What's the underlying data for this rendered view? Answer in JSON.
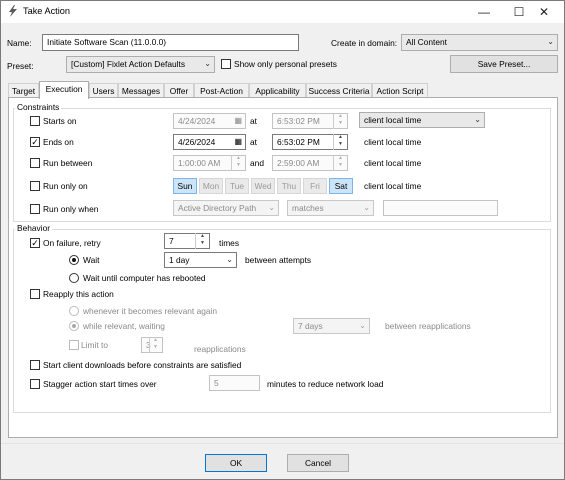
{
  "window": {
    "title": "Take Action",
    "minimize_glyph": "—",
    "maximize_glyph": "☐",
    "close_glyph": "✕"
  },
  "form": {
    "name_label": "Name:",
    "name_value": "Initiate Software Scan (11.0.0.0)",
    "domain_label": "Create in domain:",
    "domain_value": "All Content",
    "preset_label": "Preset:",
    "preset_value": "[Custom] Fixlet Action Defaults",
    "personal_presets_label": "Show only personal presets",
    "save_preset_label": "Save Preset..."
  },
  "tabs": [
    "Target",
    "Execution",
    "Users",
    "Messages",
    "Offer",
    "Post-Action",
    "Applicability",
    "Success Criteria",
    "Action Script"
  ],
  "active_tab": "Execution",
  "constraints": {
    "title": "Constraints",
    "at_label": "at",
    "and_label": "and",
    "starts_on": {
      "label": "Starts on",
      "checked": false,
      "date": "4/24/2024",
      "time": "6:53:02 PM",
      "zone": "client local time"
    },
    "ends_on": {
      "label": "Ends on",
      "checked": true,
      "check_glyph": "✓",
      "date": "4/26/2024",
      "time": "6:53:02 PM",
      "zone": "client local time"
    },
    "run_between": {
      "label": "Run between",
      "checked": false,
      "from": "1:00:00 AM",
      "to": "2:59:00 AM",
      "zone": "client local time"
    },
    "run_only_on": {
      "label": "Run only on",
      "checked": false,
      "days": [
        "Sun",
        "Mon",
        "Tue",
        "Wed",
        "Thu",
        "Fri",
        "Sat"
      ],
      "selected_days": [
        "Sun",
        "Sat"
      ],
      "zone": "client local time"
    },
    "run_only_when": {
      "label": "Run only when",
      "checked": false,
      "property": "Active Directory Path",
      "operator": "matches",
      "value": ""
    }
  },
  "behavior": {
    "title": "Behavior",
    "on_failure": {
      "label": "On failure, retry",
      "checked": true,
      "check_glyph": "✓",
      "count": "7",
      "suffix": "times"
    },
    "wait": {
      "label": "Wait",
      "selected": true,
      "value": "1 day",
      "suffix": "between attempts"
    },
    "wait_reboot": {
      "label": "Wait until computer has rebooted",
      "selected": false
    },
    "reapply": {
      "label": "Reapply this action",
      "checked": false
    },
    "relevant_again": {
      "label": "whenever it becomes relevant again",
      "selected": false
    },
    "while_relevant": {
      "label": "while relevant, waiting",
      "selected": true,
      "value": "7 days",
      "suffix": "between reapplications"
    },
    "limit": {
      "label": "Limit to",
      "checked": false,
      "value": "3",
      "suffix": "reapplications"
    },
    "start_downloads": {
      "label": "Start client downloads before constraints are satisfied",
      "checked": false
    },
    "stagger": {
      "label": "Stagger action start times over",
      "checked": false,
      "value": "5",
      "suffix": "minutes to reduce network load"
    }
  },
  "footer": {
    "ok_label": "OK",
    "cancel_label": "Cancel"
  },
  "icons": {
    "app": "lightning-icon",
    "dropdown": "chevron-down-icon",
    "calendar": "calendar-icon",
    "spin_up": "spin-up-icon",
    "spin_down": "spin-down-icon"
  },
  "glyphs": {
    "dropdown": "⌄",
    "calendar": "▦",
    "spin_up": "▲",
    "spin_down": "▼"
  },
  "colors": {
    "accent_blue": "#0078d7",
    "day_selected": "#cce4f7",
    "panel_bg": "#ffffff",
    "window_bg": "#f0f0f0"
  }
}
